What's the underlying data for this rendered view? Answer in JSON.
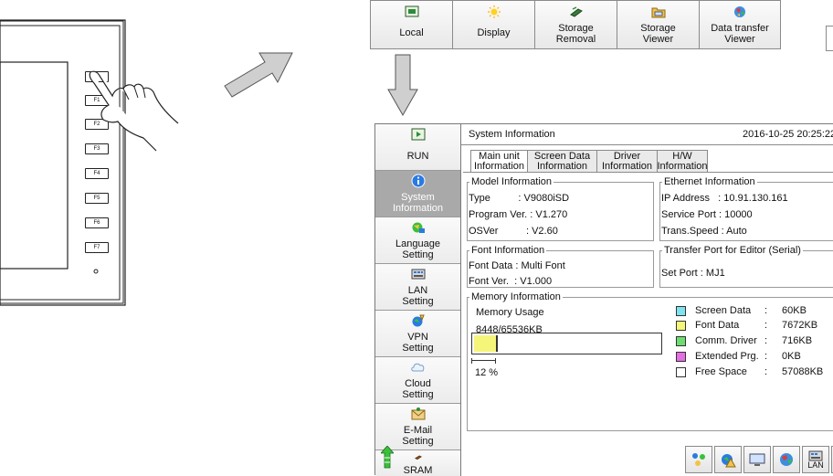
{
  "device": {
    "fkeys": [
      "F1",
      "F2",
      "F3",
      "F4",
      "F5",
      "F6",
      "F7"
    ]
  },
  "toolbar": {
    "items": [
      {
        "label": "Local",
        "icon": "local-screen-icon"
      },
      {
        "label": "Display",
        "icon": "sun-icon"
      },
      {
        "label": "Storage\nRemoval",
        "icon": "storage-removal-icon"
      },
      {
        "label": "Storage\nViewer",
        "icon": "folder-icon"
      },
      {
        "label": "Data transfer\nViewer",
        "icon": "globe-icon"
      }
    ]
  },
  "sidebar": {
    "items": [
      {
        "label": "RUN",
        "icon": "run-icon"
      },
      {
        "label": "System\nInformation",
        "icon": "info-icon",
        "active": true
      },
      {
        "label": "Language\nSetting",
        "icon": "language-icon"
      },
      {
        "label": "LAN\nSetting",
        "icon": "lan-icon"
      },
      {
        "label": "VPN\nSetting",
        "icon": "vpn-icon"
      },
      {
        "label": "Cloud\nSetting",
        "icon": "cloud-icon"
      },
      {
        "label": "E-Mail\nSetting",
        "icon": "email-icon"
      },
      {
        "label": "SRAM",
        "icon": "sram-icon"
      }
    ]
  },
  "header": {
    "title": "System Information",
    "datetime": "2016-10-25  20:25:22"
  },
  "tabs": [
    {
      "label": "Main unit\nInformation",
      "active": true
    },
    {
      "label": "Screen Data\nInformation"
    },
    {
      "label": "Driver\nInformation"
    },
    {
      "label": "H/W\nInformation"
    }
  ],
  "model": {
    "legend": "Model Information",
    "type": "Type          : V9080iSD",
    "program": "Program Ver. : V1.270",
    "os": "OSVer          : V2.60"
  },
  "ethernet": {
    "legend": "Ethernet Information",
    "ip": "IP Address   : 10.91.130.161",
    "port": "Service Port : 10000",
    "speed": "Trans.Speed : Auto"
  },
  "font": {
    "legend": "Font Information",
    "data": "Font Data : Multi Font",
    "ver": "Font Ver.  : V1.000"
  },
  "transfer": {
    "legend": "Transfer Port for Editor (Serial)",
    "port": "Set Port : MJ1"
  },
  "memory": {
    "legend": "Memory Information",
    "usage_label": "Memory Usage",
    "usage_value": "8448/65536KB",
    "percent_text": "12 %",
    "used_fraction": 0.12,
    "items": [
      {
        "name": "Screen Data",
        "size": "60KB",
        "color": "#7fe3ef"
      },
      {
        "name": "Font Data",
        "size": "7672KB",
        "color": "#f5f57a"
      },
      {
        "name": "Comm. Driver",
        "size": "716KB",
        "color": "#6fdc6f"
      },
      {
        "name": "Extended Prg.",
        "size": "0KB",
        "color": "#e36fe3"
      },
      {
        "name": "Free Space",
        "size": "57088KB",
        "color": "#ffffff"
      }
    ],
    "colon": ":"
  },
  "bottom_icons": [
    "network-users-icon",
    "vpn-warning-icon",
    "monitor-icon",
    "globe-icon",
    "lan-icon",
    "close-icon"
  ],
  "bottom_lan_label": "LAN"
}
